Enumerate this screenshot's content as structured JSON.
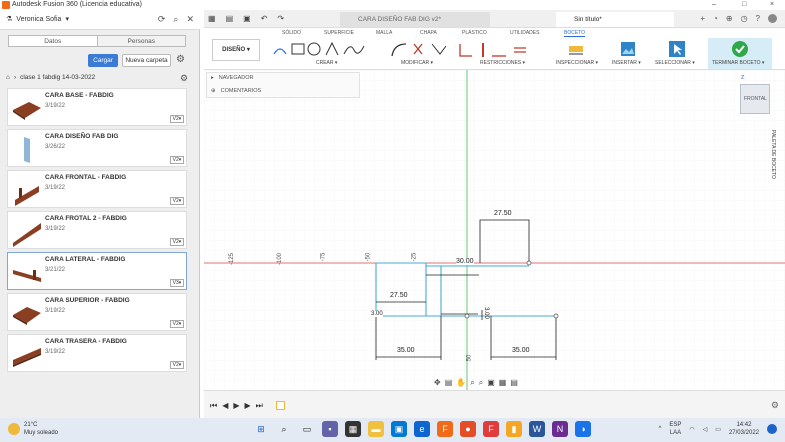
{
  "window": {
    "title": "Autodesk Fusion 360 (Licencia educativa)",
    "controls": [
      "–",
      "□",
      "×"
    ]
  },
  "left_panel": {
    "user": "Veronica Sofia",
    "tabs": [
      "Datos",
      "Personas"
    ],
    "upload_label": "Cargar",
    "new_folder_label": "Nueva carpeta",
    "breadcrumb": "clase 1 fabdig 14-03-2022",
    "files": [
      {
        "name": "CARA BASE - FABDIG",
        "date": "3/19/22",
        "version": "V2▾",
        "thumb_color": "#8a3f22"
      },
      {
        "name": "CARA DISEÑO FAB DIG",
        "date": "3/26/22",
        "version": "V2▾",
        "thumb_color": "#8fb6d8"
      },
      {
        "name": "CARA FRONTAL - FABDIG",
        "date": "3/19/22",
        "version": "V2▾",
        "thumb_color": "#8a3f22"
      },
      {
        "name": "CARA FROTAL 2 - FABDIG",
        "date": "3/19/22",
        "version": "V2▾",
        "thumb_color": "#8a3f22"
      },
      {
        "name": "CARA LATERAL - FABDIG",
        "date": "3/21/22",
        "version": "V3▾",
        "thumb_color": "#8a3f22"
      },
      {
        "name": "CARA SUPERIOR - FABDIG",
        "date": "3/19/22",
        "version": "V2▾",
        "thumb_color": "#8a3f22"
      },
      {
        "name": "CARA TRASERA - FABDIG",
        "date": "3/19/22",
        "version": "V2▾",
        "thumb_color": "#8a3f22"
      }
    ]
  },
  "doc_tabs": [
    {
      "label": "CARA DISEÑO FAB DIG v2*"
    },
    {
      "label": "Sin título*"
    }
  ],
  "toolbar": {
    "ribbon_tabs": [
      "SÓLIDO",
      "SUPERFICIE",
      "MALLA",
      "CHAPA",
      "PLÁSTICO",
      "UTILIDADES",
      "BOCETO"
    ],
    "workspace": "DISEÑO ▾",
    "groups": [
      "CREAR ▾",
      "MODIFICAR ▾",
      "RESTRICCIONES ▾",
      "INSPECCIONAR ▾",
      "INSERTAR ▾",
      "SELECCIONAR ▾",
      "TERMINAR BOCETO ▾"
    ]
  },
  "browser": {
    "navigator": "NAVEGADOR",
    "comments": "COMENTARIOS"
  },
  "viewcube": {
    "face": "FRONTAL",
    "axis": "Z"
  },
  "palette_label": "PALETA DE BOCETO",
  "ruler": {
    "labels": [
      "-125",
      "-100",
      "-75",
      "-50",
      "-25",
      "25",
      "50"
    ]
  },
  "dimensions": [
    "27.50",
    "30.00",
    "27.50",
    "3.00",
    "3.00",
    "35.00",
    "35.00"
  ],
  "taskbar": {
    "temp": "21°C",
    "weather": "Muy soleado",
    "lang1": "ESP",
    "lang2": "LAA",
    "time": "14:42",
    "date": "27/03/2022"
  },
  "colors": {
    "accent": "#2b6fd6",
    "sketch_line": "#4aa9d6",
    "dimension": "#222222",
    "y_axis": "#3cba54",
    "x_axis": "#d64545",
    "finish_green": "#2ea84a"
  }
}
